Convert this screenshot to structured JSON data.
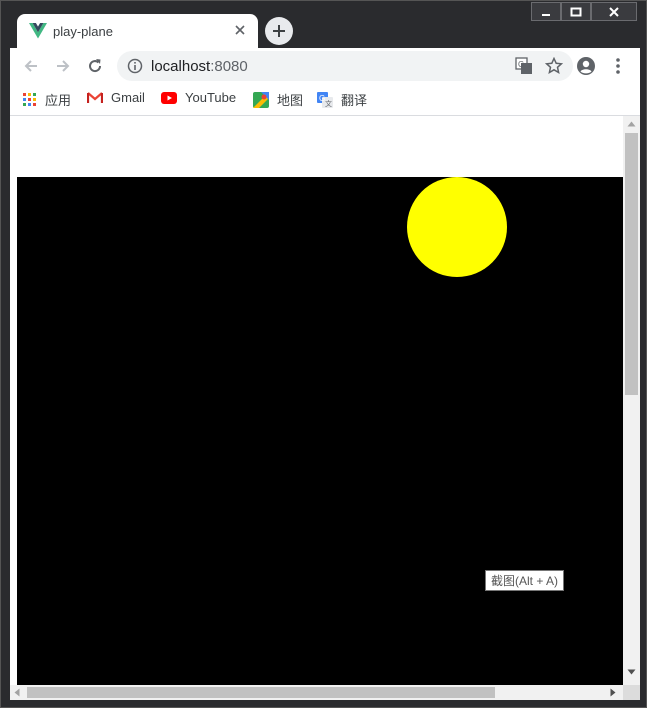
{
  "window": {
    "controls": [
      "minimize",
      "maximize",
      "close"
    ]
  },
  "tab": {
    "title": "play-plane",
    "favicon": "vue-logo-icon",
    "close_icon": "close-icon"
  },
  "toolbar": {
    "url_host": "localhost",
    "url_port": ":8080",
    "icons": [
      "back-icon",
      "forward-icon",
      "reload-icon",
      "info-icon",
      "translate-icon",
      "star-icon",
      "profile-icon",
      "menu-icon"
    ]
  },
  "bookmarks": {
    "apps": "应用",
    "gmail": "Gmail",
    "youtube": "YouTube",
    "maps": "地图",
    "translate": "翻译"
  },
  "content": {
    "canvas_color": "#000000",
    "sun_color": "#ffff00",
    "tooltip": "截图(Alt + A)"
  },
  "colors": {
    "tab_bar": "#2a2b2e",
    "accent_vue": "#41b883",
    "youtube_red": "#ff0000"
  }
}
